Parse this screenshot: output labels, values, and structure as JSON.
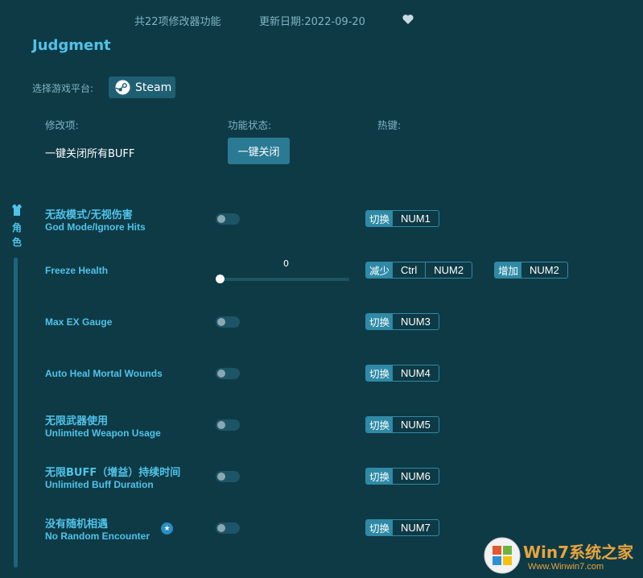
{
  "header": {
    "features": "共22项修改器功能",
    "updated": "更新日期:2022-09-20",
    "favorite_icon": "heart-icon"
  },
  "game": {
    "title": "Judgment"
  },
  "platform": {
    "label": "选择游戏平台:",
    "steam": "Steam"
  },
  "columns": {
    "modifier": "修改项:",
    "status": "功能状态:",
    "hotkey": "热键:"
  },
  "all_off": {
    "label": "一键关闭所有BUFF",
    "button": "一键关闭"
  },
  "category": {
    "icon": "character-icon",
    "line1": "角",
    "line2": "色"
  },
  "options": [
    {
      "cn": "无敌模式/无视伤害",
      "en": "God Mode/Ignore Hits",
      "action": "切换",
      "key": "NUM1",
      "on": false
    },
    {
      "cn": "",
      "en": "Freeze Health",
      "slider_value": "0",
      "dec_action": "减少",
      "dec_keys": [
        "Ctrl",
        "NUM2"
      ],
      "inc_action": "增加",
      "inc_key": "NUM2"
    },
    {
      "cn": "",
      "en": "Max EX Gauge",
      "action": "切换",
      "key": "NUM3",
      "on": false
    },
    {
      "cn": "",
      "en": "Auto Heal Mortal Wounds",
      "action": "切换",
      "key": "NUM4",
      "on": false
    },
    {
      "cn": "无限武器使用",
      "en": "Unlimited Weapon Usage",
      "action": "切换",
      "key": "NUM5",
      "on": false
    },
    {
      "cn": "无限BUFF（增益）持续时间",
      "en": "Unlimited Buff Duration",
      "action": "切换",
      "key": "NUM6",
      "on": false
    },
    {
      "cn": "没有随机相遇",
      "en": "No Random Encounter",
      "action": "切换",
      "key": "NUM7",
      "on": false,
      "badge_icon": "star-badge-icon"
    }
  ],
  "watermark": {
    "text": "Win7系统之家",
    "url": "Www.Winwin7.com"
  },
  "colors": {
    "background": "#0e3a46",
    "accent": "#4fc3e8",
    "button": "#2a7a93"
  }
}
